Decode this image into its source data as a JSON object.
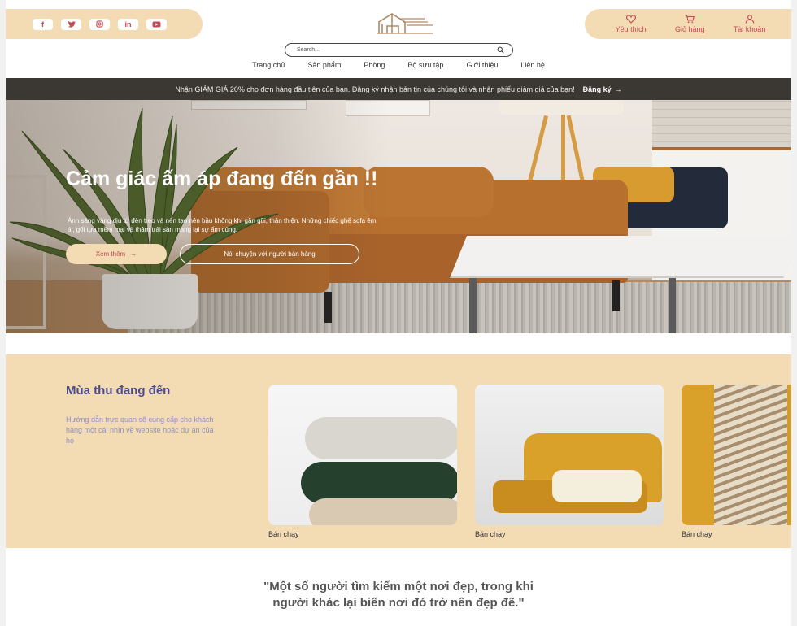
{
  "social": [
    {
      "icon": "facebook-icon",
      "glyph": "f"
    },
    {
      "icon": "twitter-icon",
      "glyph": "t"
    },
    {
      "icon": "instagram-icon",
      "glyph": "◎"
    },
    {
      "icon": "linkedin-icon",
      "glyph": "in"
    },
    {
      "icon": "youtube-icon",
      "glyph": "▶"
    }
  ],
  "account": {
    "wishlist_label": "Yêu thích",
    "cart_label": "Giỏ hàng",
    "account_label": "Tài khoản"
  },
  "search": {
    "placeholder": "Search..."
  },
  "nav": [
    "Trang chủ",
    "Sản phẩm",
    "Phòng",
    "Bộ sưu tập",
    "Giới thiệu",
    "Liên hệ"
  ],
  "promo": {
    "text": "Nhận GIẢM GIÁ 20% cho đơn hàng đầu tiên của bạn. Đăng ký nhận bản tin của chúng tôi và nhận phiếu giảm giá của bạn!",
    "link": "Đăng ký"
  },
  "hero": {
    "title": "Cảm giác ấm áp đang đến gần !!",
    "description": "Ánh sáng vàng dịu từ đèn treo và nến tạo nên bầu không khí gần gũi, thân thiện. Những chiếc ghế sofa êm ái, gối tựa mềm mại và thảm trải sàn mang lại sự ấm cúng.",
    "primary_button": "Xem thêm",
    "secondary_button": "Nói chuyện với người bán hàng"
  },
  "autumn": {
    "title": "Mùa thu đang đến",
    "description": "Hướng dẫn trực quan sẽ cung cấp cho khách hàng một cái nhìn về website hoặc dự án của họ",
    "cards": [
      {
        "label": "Bán chạy"
      },
      {
        "label": "Bán chạy"
      },
      {
        "label": "Bán chạy"
      }
    ]
  },
  "quote": {
    "line1": "\"Một số người tìm kiếm một nơi đẹp, trong khi",
    "line2": "người khác lại biến nơi đó trở nên đẹp đẽ.\""
  },
  "colors": {
    "accent": "#c24a52",
    "beige": "#f3dcb3",
    "dark": "#3b3733",
    "purple": "#4a4a8c"
  }
}
